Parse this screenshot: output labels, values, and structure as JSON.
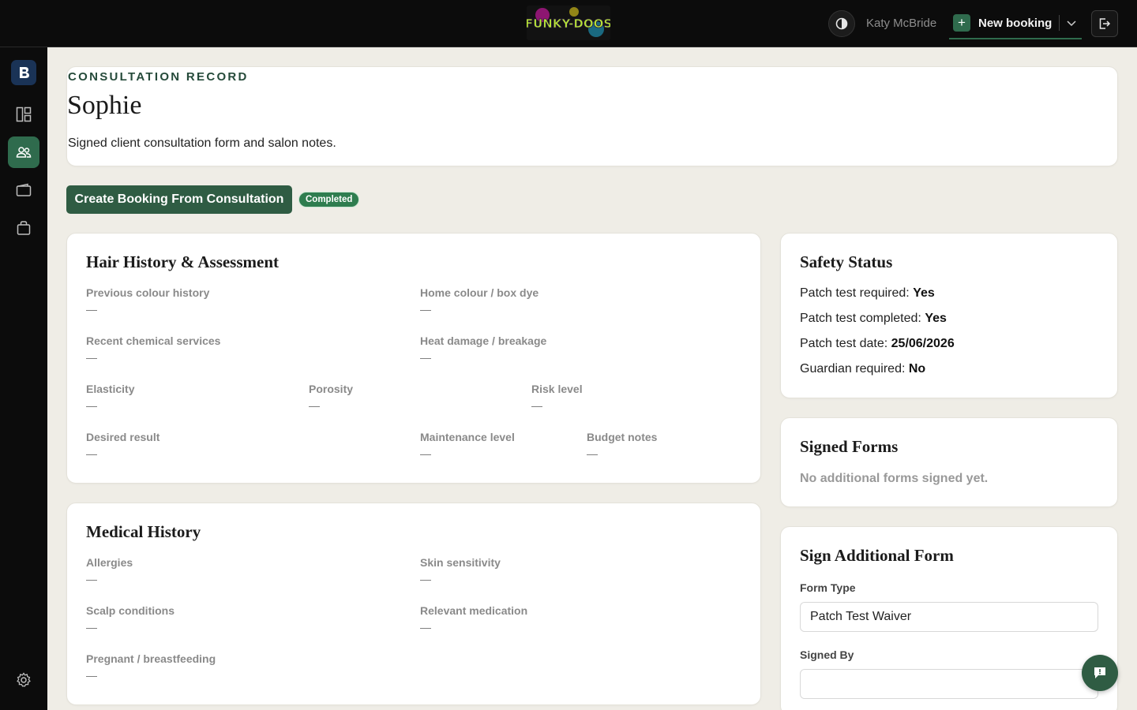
{
  "topbar": {
    "logo_text": "FUNKY-DOOS",
    "user_name": "Katy McBride",
    "new_booking_label": "New booking",
    "icons": [
      "contrast-icon",
      "plus-icon",
      "chevron-down-icon",
      "logout-icon"
    ]
  },
  "sidebar": {
    "items": [
      "brand-logo",
      "dashboard-icon",
      "clients-icon",
      "wallet-icon",
      "bag-icon",
      "gear-icon"
    ],
    "active": "clients-icon"
  },
  "header": {
    "eyebrow": "CONSULTATION RECORD",
    "client_name": "Sophie",
    "subtitle": "Signed client consultation form and salon notes."
  },
  "actions": {
    "create_booking_label": "Create Booking From Consultation",
    "status_badge": "Completed"
  },
  "hair_history": {
    "title": "Hair History & Assessment",
    "fields": [
      {
        "label": "Previous colour history",
        "value": "—"
      },
      {
        "label": "Home colour / box dye",
        "value": "—"
      },
      {
        "label": "Recent chemical services",
        "value": "—"
      },
      {
        "label": "Heat damage / breakage",
        "value": "—"
      },
      {
        "label": "Elasticity",
        "value": "—"
      },
      {
        "label": "Porosity",
        "value": "—"
      },
      {
        "label": "Risk level",
        "value": "—"
      },
      {
        "label": "Desired result",
        "value": "—"
      },
      {
        "label": "Maintenance level",
        "value": "—"
      },
      {
        "label": "Budget notes",
        "value": "—"
      }
    ]
  },
  "medical_history": {
    "title": "Medical History",
    "fields": [
      {
        "label": "Allergies",
        "value": "—"
      },
      {
        "label": "Skin sensitivity",
        "value": "—"
      },
      {
        "label": "Scalp conditions",
        "value": "—"
      },
      {
        "label": "Relevant medication",
        "value": "—"
      },
      {
        "label": "Pregnant / breastfeeding",
        "value": "—"
      }
    ]
  },
  "safety": {
    "title": "Safety Status",
    "lines": [
      {
        "label": "Patch test required:",
        "value": "Yes"
      },
      {
        "label": "Patch test completed:",
        "value": "Yes"
      },
      {
        "label": "Patch test date:",
        "value": "25/06/2026"
      },
      {
        "label": "Guardian required:",
        "value": "No"
      }
    ]
  },
  "signed_forms": {
    "title": "Signed Forms",
    "empty_text": "No additional forms signed yet."
  },
  "sign_form": {
    "title": "Sign Additional Form",
    "form_type_label": "Form Type",
    "form_type_value": "Patch Test Waiver",
    "signed_by_label": "Signed By",
    "signed_by_value": ""
  },
  "colors": {
    "accent": "#2f5c43",
    "topbar_bg": "#0c0c0c",
    "page_bg": "#efede6",
    "badge_bg": "#2f7d4f"
  }
}
